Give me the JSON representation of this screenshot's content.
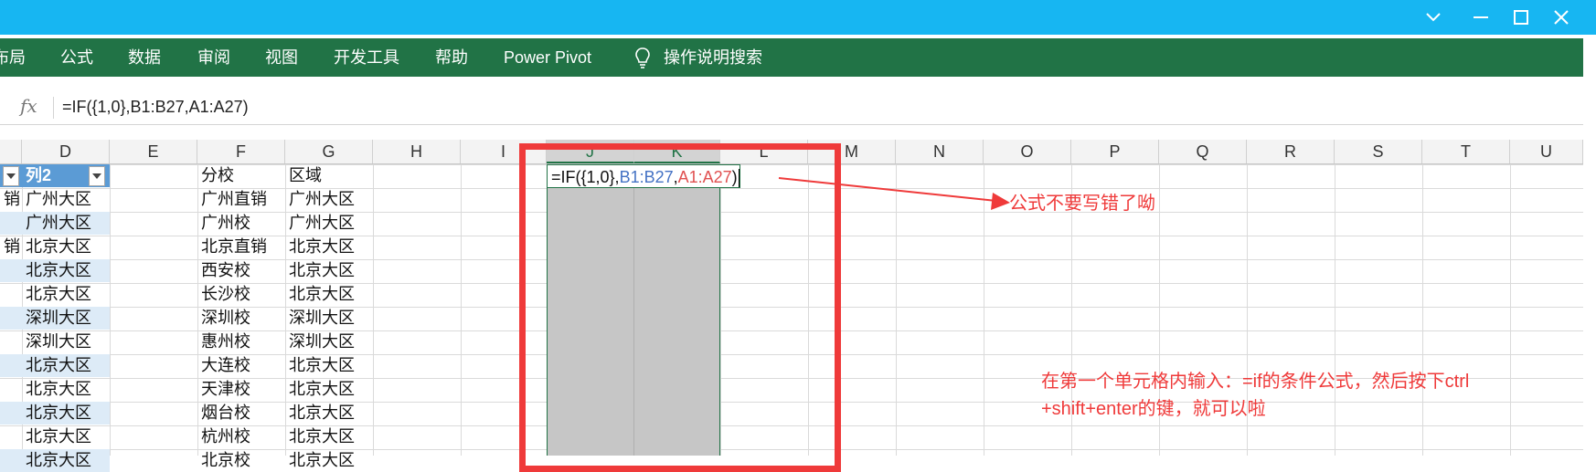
{
  "window": {
    "controls": [
      "ribbon-collapse",
      "minimize",
      "maximize",
      "close"
    ]
  },
  "ribbon": {
    "tabs": [
      "布局",
      "公式",
      "数据",
      "审阅",
      "视图",
      "开发工具",
      "帮助",
      "Power Pivot"
    ],
    "tell_me": "操作说明搜索",
    "tell_me_icon": "lightbulb-icon"
  },
  "formula_bar": {
    "fx_label": "fx",
    "formula": "=IF({1,0},B1:B27,A1:A27)"
  },
  "columns": [
    "D",
    "E",
    "F",
    "G",
    "H",
    "I",
    "J",
    "K",
    "L",
    "M",
    "N",
    "O",
    "P",
    "Q",
    "R",
    "S",
    "T",
    "U"
  ],
  "table": {
    "header_d": "列2",
    "header_f": "分校",
    "header_g": "区域",
    "col_c_fragments": [
      "销",
      "",
      "销",
      "",
      "",
      "",
      "",
      "",
      "",
      "",
      "",
      ""
    ],
    "col_d": [
      "广州大区",
      "广州大区",
      "北京大区",
      "北京大区",
      "北京大区",
      "深圳大区",
      "深圳大区",
      "北京大区",
      "北京大区",
      "北京大区",
      "北京大区",
      "北京大区"
    ],
    "col_f": [
      "广州直销",
      "广州校",
      "北京直销",
      "西安校",
      "长沙校",
      "深圳校",
      "惠州校",
      "大连校",
      "天津校",
      "烟台校",
      "杭州校",
      "北京校"
    ],
    "col_g": [
      "广州大区",
      "广州大区",
      "北京大区",
      "北京大区",
      "北京大区",
      "深圳大区",
      "深圳大区",
      "北京大区",
      "北京大区",
      "北京大区",
      "北京大区",
      "北京大区"
    ]
  },
  "editing_cell": {
    "part1": "=IF({1,0},",
    "part2": "B1:B27",
    "part3": ",",
    "part4": "A1:A27",
    "part5": ")",
    "color_ref1": "#4472c4",
    "color_ref2": "#e05050"
  },
  "annotations": {
    "arrow_note": "公式不要写错了呦",
    "instruction_line1": "在第一个单元格内输入：=if的条件公式，然后按下ctrl",
    "instruction_line2": "+shift+enter的键，就可以啦",
    "color": "#ef3a3a"
  },
  "colors": {
    "titlebar": "#17b6f2",
    "ribbon": "#217346",
    "table_header": "#5b9bd5",
    "band": "#ddebf7"
  }
}
